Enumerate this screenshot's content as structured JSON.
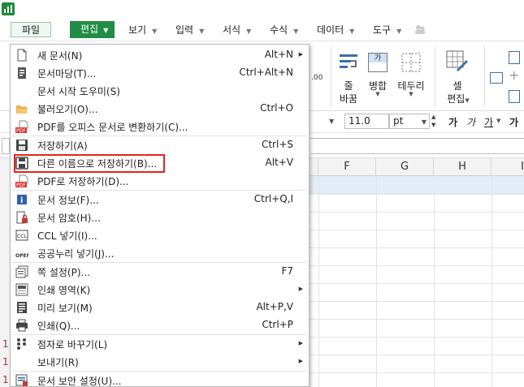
{
  "menubar": {
    "file": "파일",
    "edit": "편집",
    "items": [
      "보기",
      "입력",
      "서식",
      "수식",
      "데이터",
      "도구"
    ]
  },
  "ribbon": {
    "wrap_line1": "줄",
    "wrap_line2": "바꿈",
    "merge": "병합",
    "border": "테두리",
    "cell_line1": "셀",
    "cell_line2": "편집"
  },
  "format_bar": {
    "font_size": "11.0",
    "unit": "pt",
    "font_buttons": [
      "가",
      "가",
      "가",
      "가"
    ]
  },
  "grid": {
    "columns": [
      "F",
      "G",
      "H",
      "I"
    ],
    "row_numbers": [
      "1",
      "1",
      "1"
    ]
  },
  "file_menu": {
    "items": [
      {
        "label": "새 문서(N)",
        "shortcut": "Alt+N",
        "submenu": true,
        "icon": "new-document-icon"
      },
      {
        "label": "문서마당(T)...",
        "shortcut": "Ctrl+Alt+N",
        "submenu": false,
        "icon": "template-icon"
      },
      {
        "label": "문서 시작 도우미(S)",
        "shortcut": "",
        "submenu": false,
        "icon": ""
      },
      {
        "label": "불러오기(O)...",
        "shortcut": "Ctrl+O",
        "submenu": false,
        "icon": "folder-open-icon"
      },
      {
        "label": "PDF를 오피스 문서로 변환하기(C)...",
        "shortcut": "",
        "submenu": false,
        "icon": "pdf-convert-icon"
      },
      {
        "label": "저장하기(A)",
        "shortcut": "Ctrl+S",
        "submenu": false,
        "icon": "save-icon"
      },
      {
        "label": "다른 이름으로 저장하기(B)...",
        "shortcut": "Alt+V",
        "submenu": false,
        "icon": "save-as-icon"
      },
      {
        "label": "PDF로 저장하기(D)...",
        "shortcut": "",
        "submenu": false,
        "icon": "pdf-save-icon"
      },
      {
        "label": "문서 정보(F)...",
        "shortcut": "Ctrl+Q,I",
        "submenu": false,
        "icon": "info-icon"
      },
      {
        "label": "문서 암호(H)...",
        "shortcut": "",
        "submenu": false,
        "icon": "lock-document-icon"
      },
      {
        "label": "CCL 넣기(I)...",
        "shortcut": "",
        "submenu": false,
        "icon": "ccl-icon"
      },
      {
        "label": "공공누리 넣기(J)...",
        "shortcut": "",
        "submenu": false,
        "icon": "open-license-icon"
      },
      {
        "label": "쪽 설정(P)...",
        "shortcut": "F7",
        "submenu": false,
        "icon": "page-setup-icon"
      },
      {
        "label": "인쇄 영역(K)",
        "shortcut": "",
        "submenu": true,
        "icon": "print-area-icon"
      },
      {
        "label": "미리 보기(M)",
        "shortcut": "Alt+P,V",
        "submenu": false,
        "icon": "preview-icon"
      },
      {
        "label": "인쇄(Q)...",
        "shortcut": "Ctrl+P",
        "submenu": false,
        "icon": "printer-icon"
      },
      {
        "label": "점자로 바꾸기(L)",
        "shortcut": "",
        "submenu": true,
        "icon": "braille-icon"
      },
      {
        "label": "보내기(R)",
        "shortcut": "",
        "submenu": true,
        "icon": ""
      },
      {
        "label": "문서 보안 설정(U)...",
        "shortcut": "",
        "submenu": false,
        "icon": "security-icon"
      }
    ]
  }
}
